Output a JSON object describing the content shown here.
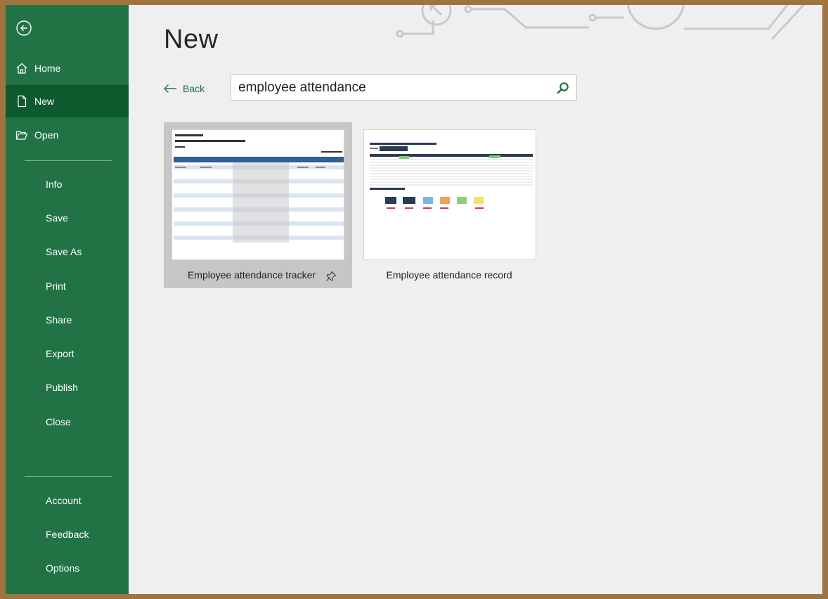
{
  "sidebar": {
    "top_items": [
      {
        "label": "Home",
        "icon": "home-icon"
      },
      {
        "label": "New",
        "icon": "new-document-icon",
        "selected": true
      },
      {
        "label": "Open",
        "icon": "folder-open-icon"
      }
    ],
    "middle_items": [
      "Info",
      "Save",
      "Save As",
      "Print",
      "Share",
      "Export",
      "Publish",
      "Close"
    ],
    "bottom_items": [
      "Account",
      "Feedback",
      "Options"
    ]
  },
  "main": {
    "title": "New",
    "back_label": "Back",
    "search": {
      "value": "employee attendance"
    },
    "templates": [
      {
        "name": "Employee attendance tracker",
        "selected": true,
        "pinnable": true
      },
      {
        "name": "Employee attendance record",
        "selected": false
      }
    ]
  },
  "colors": {
    "sidebar": "#217346",
    "sidebar_selected": "#0e5a2f",
    "accent": "#217346",
    "page_bg": "#efefef"
  }
}
